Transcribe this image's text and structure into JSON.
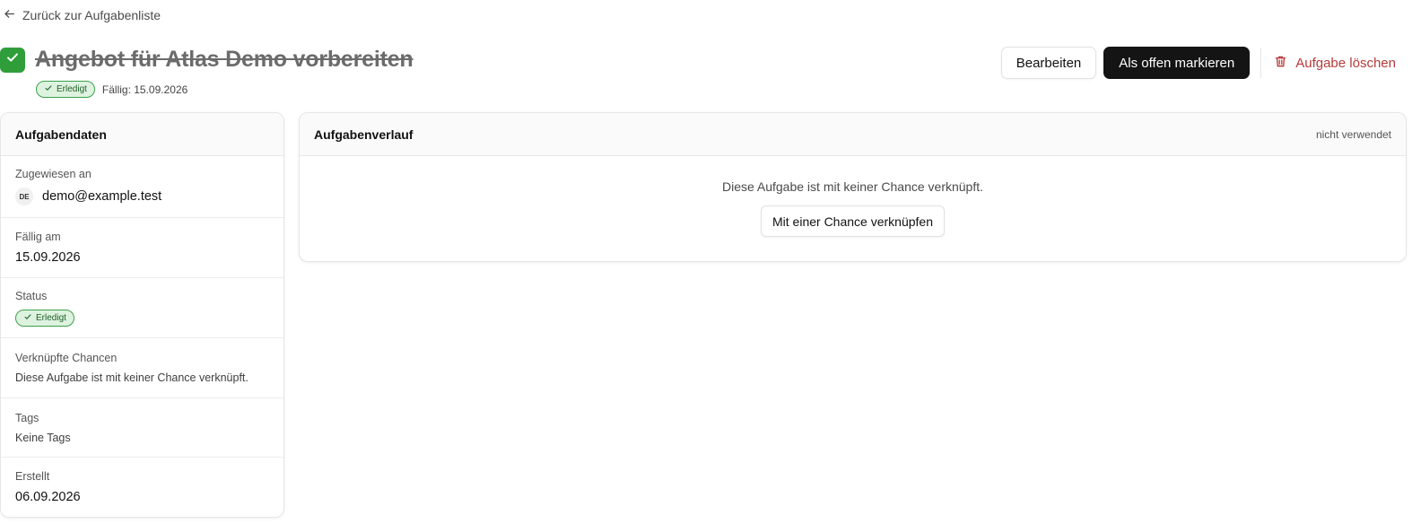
{
  "nav": {
    "back_label": "Zurück zur Aufgabenliste"
  },
  "task": {
    "title": "Angebot für Atlas Demo vorbereiten",
    "status_badge": "Erledigt",
    "due_line": "Fällig: 15.09.2026"
  },
  "actions": {
    "edit_label": "Bearbeiten",
    "mark_open_label": "Als offen markieren",
    "delete_label": "Aufgabe löschen"
  },
  "details": {
    "title": "Aufgabendaten",
    "assigned_label": "Zugewiesen an",
    "assignee_initials": "DE",
    "assignee_email": "demo@example.test",
    "due_label": "Fällig am",
    "due_value": "15.09.2026",
    "status_label": "Status",
    "status_value": "Erledigt",
    "linked_label": "Verknüpfte Chancen",
    "linked_value": "Diese Aufgabe ist mit keiner Chance verknüpft.",
    "tags_label": "Tags",
    "tags_value": "Keine Tags",
    "created_label": "Erstellt",
    "created_value": "06.09.2026"
  },
  "history": {
    "title": "Aufgabenverlauf",
    "note": "nicht verwendet",
    "empty_text": "Diese Aufgabe ist mit keiner Chance verknüpft.",
    "link_button": "Mit einer Chance verknüpfen"
  },
  "colors": {
    "accent_dark": "#141414",
    "done_green": "#2f9e3a",
    "badge_bg": "#def3df",
    "danger": "#b63a3a"
  }
}
